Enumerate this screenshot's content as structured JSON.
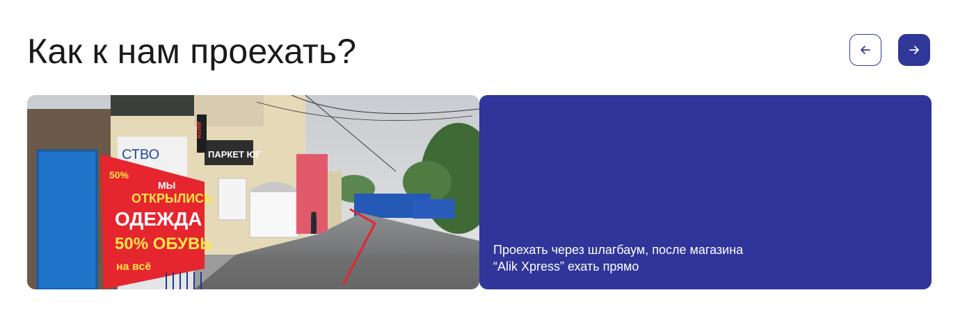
{
  "section": {
    "title": "Как к нам проехать?"
  },
  "carousel": {
    "prev_icon": "arrow-left-icon",
    "next_icon": "arrow-right-icon",
    "accent_color": "#2f3799"
  },
  "slide": {
    "photo": {
      "subject": "street-view-photo",
      "sign_banner": {
        "line1": "МЫ",
        "line2": "ОТКРЫЛИСЬ",
        "line3": "ОДЕЖДА",
        "line4": "50% ОБУВЬ",
        "line5": "на всё",
        "percent_tag": "50%"
      },
      "shop_sign_parket": "ПАРКЕТ ЮГ",
      "shop_sign_dveri": "ДВЕРИ",
      "shop_sign_ctvo": "СТВО"
    },
    "directions": "Проехать через шлагбаум, после магазина “Alik Xpress” ехать прямо"
  }
}
